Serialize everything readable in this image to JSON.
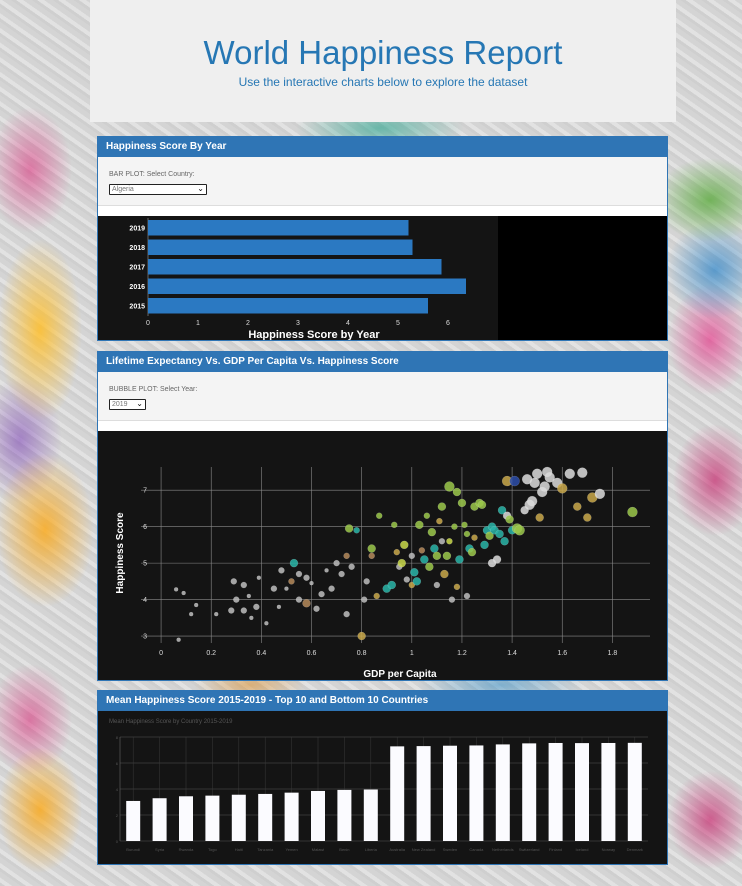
{
  "header": {
    "title": "World Happiness Report",
    "subtitle": "Use the interactive charts below to explore the dataset"
  },
  "panel1": {
    "title": "Happiness Score By Year",
    "control_label": "BAR PLOT: Select Country:",
    "selected_country": "Algeria"
  },
  "panel2": {
    "title": "Lifetime Expectancy Vs. GDP Per Capita Vs. Happiness Score",
    "control_label": "BUBBLE PLOT: Select Year:",
    "selected_year": "2019"
  },
  "panel3": {
    "title": "Mean Happiness Score 2015-2019 - Top 10 and Bottom 10 Countries",
    "chart_title": "Mean Happiness Score by Country 2015-2019"
  },
  "colors": {
    "accent": "#2f75b5",
    "bar": "#2b79c2",
    "chart_bg": "#141414"
  },
  "chart_data": [
    {
      "type": "bar",
      "orientation": "horizontal",
      "categories": [
        "2019",
        "2018",
        "2017",
        "2016",
        "2015"
      ],
      "values": [
        5.21,
        5.29,
        5.87,
        6.36,
        5.6
      ],
      "xlabel": "Happiness Score by Year",
      "xlim": [
        0,
        7
      ],
      "xticks": [
        "0",
        "1",
        "2",
        "3",
        "4",
        "5",
        "6"
      ]
    },
    {
      "type": "scatter",
      "xlabel": "GDP per Capita",
      "ylabel": "Happiness Score",
      "xlim": [
        -0.1,
        1.95
      ],
      "ylim": [
        2.7,
        7.8
      ],
      "xticks": [
        "0",
        "0.2",
        "0.4",
        "0.6",
        "0.8",
        "1",
        "1.2",
        "1.4",
        "1.6",
        "1.8"
      ],
      "yticks": [
        "3",
        "4",
        "5",
        "6",
        "7"
      ],
      "grid": true,
      "points": [
        {
          "x": 0.06,
          "y": 4.28,
          "s": 2,
          "c": "#bdbdbd"
        },
        {
          "x": 0.09,
          "y": 4.18,
          "s": 2,
          "c": "#bdbdbd"
        },
        {
          "x": 0.07,
          "y": 2.9,
          "s": 2,
          "c": "#bdbdbd"
        },
        {
          "x": 0.12,
          "y": 3.6,
          "s": 2,
          "c": "#bdbdbd"
        },
        {
          "x": 0.14,
          "y": 3.85,
          "s": 2,
          "c": "#bdbdbd"
        },
        {
          "x": 0.22,
          "y": 3.6,
          "s": 2,
          "c": "#bdbdbd"
        },
        {
          "x": 0.28,
          "y": 3.7,
          "s": 3,
          "c": "#bdbdbd"
        },
        {
          "x": 0.29,
          "y": 4.5,
          "s": 3,
          "c": "#bdbdbd"
        },
        {
          "x": 0.3,
          "y": 4.0,
          "s": 3,
          "c": "#bdbdbd"
        },
        {
          "x": 0.33,
          "y": 3.7,
          "s": 3,
          "c": "#bdbdbd"
        },
        {
          "x": 0.33,
          "y": 4.4,
          "s": 3,
          "c": "#bdbdbd"
        },
        {
          "x": 0.35,
          "y": 4.1,
          "s": 2,
          "c": "#bdbdbd"
        },
        {
          "x": 0.36,
          "y": 3.5,
          "s": 2,
          "c": "#bdbdbd"
        },
        {
          "x": 0.38,
          "y": 3.8,
          "s": 3,
          "c": "#bdbdbd"
        },
        {
          "x": 0.39,
          "y": 4.6,
          "s": 2,
          "c": "#bdbdbd"
        },
        {
          "x": 0.42,
          "y": 3.35,
          "s": 2,
          "c": "#bdbdbd"
        },
        {
          "x": 0.45,
          "y": 4.3,
          "s": 3,
          "c": "#bdbdbd"
        },
        {
          "x": 0.47,
          "y": 3.8,
          "s": 2,
          "c": "#bdbdbd"
        },
        {
          "x": 0.48,
          "y": 4.8,
          "s": 3,
          "c": "#bdbdbd"
        },
        {
          "x": 0.5,
          "y": 4.3,
          "s": 2,
          "c": "#bdbdbd"
        },
        {
          "x": 0.52,
          "y": 4.5,
          "s": 3,
          "c": "#b58a5a"
        },
        {
          "x": 0.53,
          "y": 5.0,
          "s": 4,
          "c": "#29b5a8"
        },
        {
          "x": 0.55,
          "y": 4.7,
          "s": 3,
          "c": "#bdbdbd"
        },
        {
          "x": 0.55,
          "y": 4.0,
          "s": 3,
          "c": "#bdbdbd"
        },
        {
          "x": 0.58,
          "y": 4.6,
          "s": 3,
          "c": "#bdbdbd"
        },
        {
          "x": 0.58,
          "y": 3.9,
          "s": 4,
          "c": "#b58a5a"
        },
        {
          "x": 0.6,
          "y": 4.45,
          "s": 2,
          "c": "#bdbdbd"
        },
        {
          "x": 0.62,
          "y": 3.75,
          "s": 3,
          "c": "#bdbdbd"
        },
        {
          "x": 0.64,
          "y": 4.15,
          "s": 3,
          "c": "#bdbdbd"
        },
        {
          "x": 0.66,
          "y": 4.8,
          "s": 2,
          "c": "#bdbdbd"
        },
        {
          "x": 0.68,
          "y": 4.3,
          "s": 3,
          "c": "#bdbdbd"
        },
        {
          "x": 0.7,
          "y": 5.0,
          "s": 3,
          "c": "#bdbdbd"
        },
        {
          "x": 0.72,
          "y": 4.7,
          "s": 3,
          "c": "#bdbdbd"
        },
        {
          "x": 0.74,
          "y": 3.6,
          "s": 3,
          "c": "#bdbdbd"
        },
        {
          "x": 0.74,
          "y": 5.2,
          "s": 3,
          "c": "#b58a5a"
        },
        {
          "x": 0.75,
          "y": 5.95,
          "s": 4,
          "c": "#9bc84a"
        },
        {
          "x": 0.76,
          "y": 4.9,
          "s": 3,
          "c": "#bdbdbd"
        },
        {
          "x": 0.78,
          "y": 5.9,
          "s": 3,
          "c": "#29b5a8"
        },
        {
          "x": 0.8,
          "y": 3.0,
          "s": 4,
          "c": "#c9a84a"
        },
        {
          "x": 0.81,
          "y": 4.0,
          "s": 3,
          "c": "#bdbdbd"
        },
        {
          "x": 0.82,
          "y": 4.5,
          "s": 3,
          "c": "#bdbdbd"
        },
        {
          "x": 0.84,
          "y": 5.2,
          "s": 3,
          "c": "#b58a5a"
        },
        {
          "x": 0.84,
          "y": 5.4,
          "s": 4,
          "c": "#9bc84a"
        },
        {
          "x": 0.86,
          "y": 4.1,
          "s": 3,
          "c": "#c9a84a"
        },
        {
          "x": 0.87,
          "y": 6.3,
          "s": 3,
          "c": "#9bc84a"
        },
        {
          "x": 0.9,
          "y": 4.3,
          "s": 4,
          "c": "#29b5a8"
        },
        {
          "x": 0.92,
          "y": 4.4,
          "s": 4,
          "c": "#29b5a8"
        },
        {
          "x": 0.93,
          "y": 6.05,
          "s": 3,
          "c": "#9bc84a"
        },
        {
          "x": 0.94,
          "y": 5.3,
          "s": 3,
          "c": "#c9a84a"
        },
        {
          "x": 0.95,
          "y": 4.9,
          "s": 3,
          "c": "#bdbdbd"
        },
        {
          "x": 0.96,
          "y": 5.0,
          "s": 4,
          "c": "#c9d84a"
        },
        {
          "x": 0.97,
          "y": 5.5,
          "s": 4,
          "c": "#c9d84a"
        },
        {
          "x": 0.98,
          "y": 4.55,
          "s": 3,
          "c": "#bdbdbd"
        },
        {
          "x": 1.0,
          "y": 5.2,
          "s": 3,
          "c": "#bdbdbd"
        },
        {
          "x": 1.0,
          "y": 4.4,
          "s": 3,
          "c": "#c9a84a"
        },
        {
          "x": 1.01,
          "y": 4.75,
          "s": 4,
          "c": "#29b5a8"
        },
        {
          "x": 1.02,
          "y": 4.5,
          "s": 4,
          "c": "#29b5a8"
        },
        {
          "x": 1.03,
          "y": 6.05,
          "s": 4,
          "c": "#9bc84a"
        },
        {
          "x": 1.04,
          "y": 5.35,
          "s": 3,
          "c": "#b58a5a"
        },
        {
          "x": 1.05,
          "y": 5.1,
          "s": 4,
          "c": "#29b5a8"
        },
        {
          "x": 1.06,
          "y": 6.3,
          "s": 3,
          "c": "#9bc84a"
        },
        {
          "x": 1.07,
          "y": 4.9,
          "s": 4,
          "c": "#9bc84a"
        },
        {
          "x": 1.08,
          "y": 5.85,
          "s": 4,
          "c": "#9bc84a"
        },
        {
          "x": 1.09,
          "y": 5.4,
          "s": 4,
          "c": "#29b5a8"
        },
        {
          "x": 1.1,
          "y": 4.4,
          "s": 3,
          "c": "#bdbdbd"
        },
        {
          "x": 1.1,
          "y": 5.2,
          "s": 4,
          "c": "#9bc84a"
        },
        {
          "x": 1.11,
          "y": 6.15,
          "s": 3,
          "c": "#c9a84a"
        },
        {
          "x": 1.12,
          "y": 5.6,
          "s": 3,
          "c": "#bdbdbd"
        },
        {
          "x": 1.12,
          "y": 6.55,
          "s": 4,
          "c": "#9bc84a"
        },
        {
          "x": 1.13,
          "y": 4.7,
          "s": 4,
          "c": "#c9a84a"
        },
        {
          "x": 1.14,
          "y": 5.2,
          "s": 4,
          "c": "#9bc84a"
        },
        {
          "x": 1.15,
          "y": 7.1,
          "s": 5,
          "c": "#9bc84a"
        },
        {
          "x": 1.15,
          "y": 5.6,
          "s": 3,
          "c": "#c9d84a"
        },
        {
          "x": 1.16,
          "y": 4.0,
          "s": 3,
          "c": "#bdbdbd"
        },
        {
          "x": 1.17,
          "y": 6.0,
          "s": 3,
          "c": "#9bc84a"
        },
        {
          "x": 1.18,
          "y": 4.35,
          "s": 3,
          "c": "#c9a84a"
        },
        {
          "x": 1.18,
          "y": 6.95,
          "s": 4,
          "c": "#9bc84a"
        },
        {
          "x": 1.19,
          "y": 5.1,
          "s": 4,
          "c": "#29b5a8"
        },
        {
          "x": 1.2,
          "y": 6.65,
          "s": 4,
          "c": "#9bc84a"
        },
        {
          "x": 1.21,
          "y": 6.05,
          "s": 3,
          "c": "#9bc84a"
        },
        {
          "x": 1.22,
          "y": 5.8,
          "s": 3,
          "c": "#9bc84a"
        },
        {
          "x": 1.22,
          "y": 4.1,
          "s": 3,
          "c": "#bdbdbd"
        },
        {
          "x": 1.23,
          "y": 5.4,
          "s": 4,
          "c": "#29b5a8"
        },
        {
          "x": 1.24,
          "y": 5.3,
          "s": 4,
          "c": "#9bc84a"
        },
        {
          "x": 1.25,
          "y": 6.55,
          "s": 4,
          "c": "#9bc84a"
        },
        {
          "x": 1.25,
          "y": 5.7,
          "s": 3,
          "c": "#c9a84a"
        },
        {
          "x": 1.27,
          "y": 6.65,
          "s": 4,
          "c": "#9bc84a"
        },
        {
          "x": 1.28,
          "y": 6.6,
          "s": 4,
          "c": "#9bc84a"
        },
        {
          "x": 1.29,
          "y": 5.5,
          "s": 4,
          "c": "#29b5a8"
        },
        {
          "x": 1.3,
          "y": 5.9,
          "s": 4,
          "c": "#29b5a8"
        },
        {
          "x": 1.31,
          "y": 5.75,
          "s": 4,
          "c": "#9bc84a"
        },
        {
          "x": 1.32,
          "y": 5.0,
          "s": 4,
          "c": "#dcdcdc"
        },
        {
          "x": 1.32,
          "y": 6.0,
          "s": 4,
          "c": "#29b5a8"
        },
        {
          "x": 1.33,
          "y": 5.9,
          "s": 4,
          "c": "#29b5a8"
        },
        {
          "x": 1.34,
          "y": 5.1,
          "s": 4,
          "c": "#dcdcdc"
        },
        {
          "x": 1.35,
          "y": 5.8,
          "s": 4,
          "c": "#29b5a8"
        },
        {
          "x": 1.36,
          "y": 6.45,
          "s": 4,
          "c": "#29b5a8"
        },
        {
          "x": 1.37,
          "y": 5.6,
          "s": 4,
          "c": "#29b5a8"
        },
        {
          "x": 1.38,
          "y": 6.3,
          "s": 4,
          "c": "#dcdcdc"
        },
        {
          "x": 1.38,
          "y": 7.25,
          "s": 5,
          "c": "#c9a84a"
        },
        {
          "x": 1.39,
          "y": 6.2,
          "s": 4,
          "c": "#9bc84a"
        },
        {
          "x": 1.4,
          "y": 5.9,
          "s": 4,
          "c": "#29b5a8"
        },
        {
          "x": 1.41,
          "y": 7.25,
          "s": 5,
          "c": "#2b4ca8"
        },
        {
          "x": 1.42,
          "y": 5.95,
          "s": 5,
          "c": "#9bc84a"
        },
        {
          "x": 1.43,
          "y": 5.9,
          "s": 5,
          "c": "#9bc84a"
        },
        {
          "x": 1.45,
          "y": 6.45,
          "s": 4,
          "c": "#dcdcdc"
        },
        {
          "x": 1.46,
          "y": 7.3,
          "s": 5,
          "c": "#dcdcdc"
        },
        {
          "x": 1.47,
          "y": 6.6,
          "s": 5,
          "c": "#dcdcdc"
        },
        {
          "x": 1.48,
          "y": 6.7,
          "s": 5,
          "c": "#dcdcdc"
        },
        {
          "x": 1.49,
          "y": 7.2,
          "s": 5,
          "c": "#dcdcdc"
        },
        {
          "x": 1.5,
          "y": 7.45,
          "s": 5,
          "c": "#dcdcdc"
        },
        {
          "x": 1.51,
          "y": 6.25,
          "s": 4,
          "c": "#c9a84a"
        },
        {
          "x": 1.52,
          "y": 6.95,
          "s": 5,
          "c": "#dcdcdc"
        },
        {
          "x": 1.53,
          "y": 7.1,
          "s": 5,
          "c": "#dcdcdc"
        },
        {
          "x": 1.54,
          "y": 7.5,
          "s": 5,
          "c": "#dcdcdc"
        },
        {
          "x": 1.55,
          "y": 7.35,
          "s": 5,
          "c": "#dcdcdc"
        },
        {
          "x": 1.58,
          "y": 7.2,
          "s": 5,
          "c": "#dcdcdc"
        },
        {
          "x": 1.6,
          "y": 7.05,
          "s": 5,
          "c": "#c9a84a"
        },
        {
          "x": 1.63,
          "y": 7.45,
          "s": 5,
          "c": "#dcdcdc"
        },
        {
          "x": 1.66,
          "y": 6.55,
          "s": 4,
          "c": "#c9a84a"
        },
        {
          "x": 1.68,
          "y": 7.48,
          "s": 5,
          "c": "#dcdcdc"
        },
        {
          "x": 1.7,
          "y": 6.25,
          "s": 4,
          "c": "#c9a84a"
        },
        {
          "x": 1.72,
          "y": 6.8,
          "s": 5,
          "c": "#c9a84a"
        },
        {
          "x": 1.75,
          "y": 6.9,
          "s": 5,
          "c": "#dcdcdc"
        },
        {
          "x": 1.88,
          "y": 6.4,
          "s": 5,
          "c": "#9bc84a"
        }
      ]
    },
    {
      "type": "bar",
      "title": "Mean Happiness Score by Country 2015-2019",
      "categories": [
        "Burundi",
        "Syria",
        "Rwanda",
        "Togo",
        "Haiti",
        "Tanzania",
        "Yemen",
        "Malawi",
        "Benin",
        "Liberia",
        "Australia",
        "New Zealand",
        "Sweden",
        "Canada",
        "Netherlands",
        "Switzerland",
        "Finland",
        "Iceland",
        "Norway",
        "Denmark"
      ],
      "values": [
        3.08,
        3.29,
        3.44,
        3.49,
        3.56,
        3.62,
        3.72,
        3.85,
        3.93,
        3.96,
        7.28,
        7.3,
        7.33,
        7.35,
        7.43,
        7.51,
        7.54,
        7.53,
        7.54,
        7.55
      ],
      "ylim": [
        0,
        8
      ],
      "yticks": [
        "0",
        "2",
        "4",
        "6",
        "8"
      ],
      "grid": true
    }
  ]
}
